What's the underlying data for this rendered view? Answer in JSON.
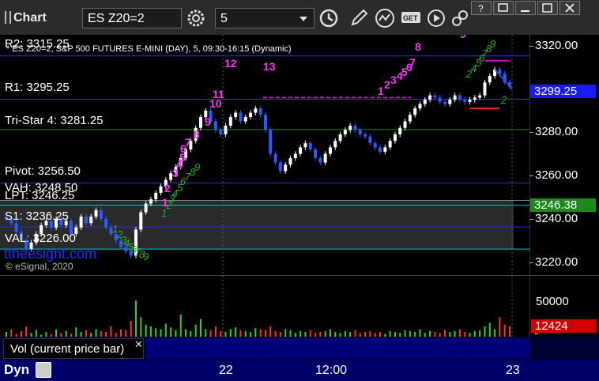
{
  "app": {
    "title": "Chart"
  },
  "toolbar": {
    "symbol": "ES Z20=2",
    "interval": "5"
  },
  "chart_subtitle": "* ES Z20=2, S&P 500 FUTURES E-MINI (DAY), 5, 09:30-16:15 (Dynamic)",
  "watermark": "ttheesight.com",
  "copyright": "© eSignal, 2020",
  "levels": [
    {
      "label": "R2: 3315.25",
      "price": 3315.25,
      "color": "#2b2bff"
    },
    {
      "label": "R1: 3295.25",
      "price": 3295.25,
      "color": "#2b2bff"
    },
    {
      "label": "Tri-Star 4: 3281.25",
      "price": 3281.25,
      "color": "#2e7d32"
    },
    {
      "label": "Pivot: 3256.50",
      "price": 3256.5,
      "color": "#2b2bff"
    },
    {
      "label": "LPT: 3246.25",
      "price": 3246.25,
      "color": "#00c8c8"
    },
    {
      "label": "VAH: 3248.50",
      "price": 3248.5,
      "color": "#888888"
    },
    {
      "label": "S1: 3236.25",
      "price": 3236.25,
      "color": "#2b2bff"
    },
    {
      "label": "VAL: 3226.00",
      "price": 3226.0,
      "color": "#00c8c8"
    }
  ],
  "price_scale": {
    "ticks": [
      "3320.00",
      "3280.00",
      "3260.00",
      "3240.00",
      "3220.00"
    ]
  },
  "price_badges": [
    {
      "text": "3299.25",
      "price": 3299.25,
      "color": "#1a1aff"
    },
    {
      "text": "3246.38",
      "price": 3246.38,
      "color": "#1a8a1a"
    }
  ],
  "volume": {
    "label": "Vol (current price bar)",
    "ticks": [
      "50000",
      "0"
    ],
    "badge": "12424",
    "badge_color": "#d00000"
  },
  "time_axis": {
    "labels": [
      "22",
      "12:00",
      "23"
    ]
  },
  "bottom": {
    "mode": "Dyn"
  },
  "annotations": {
    "magenta_counts": [
      "1",
      "2",
      "3",
      "4",
      "5",
      "6",
      "7",
      "8",
      "9",
      "10",
      "11",
      "12",
      "13",
      "1",
      "2",
      "3",
      "4",
      "5",
      "6",
      "7",
      "8",
      "9",
      "10",
      "1",
      "2"
    ],
    "green_counts": [
      "1",
      "2",
      "3",
      "4",
      "5",
      "6",
      "7",
      "8",
      "9",
      "1",
      "2",
      "3",
      "4",
      "5",
      "6",
      "7",
      "8",
      "9",
      "2",
      "4",
      "5",
      "6",
      "7",
      "8",
      "9",
      "2"
    ]
  },
  "chart_data": {
    "type": "candlestick",
    "title": "ES Z20=2, S&P 500 FUTURES E-MINI (DAY), 5, 09:30-16:15 (Dynamic)",
    "ylim": [
      3214,
      3325
    ],
    "x_labels": [
      "22",
      "12:00",
      "23"
    ],
    "series": [
      {
        "name": "price",
        "values": [
          3240,
          3238,
          3234,
          3230,
          3226,
          3229,
          3233,
          3237,
          3239,
          3236,
          3240,
          3237,
          3239,
          3233,
          3236,
          3241,
          3238,
          3241,
          3244,
          3240,
          3236,
          3233,
          3230,
          3227,
          3225,
          3223,
          3235,
          3243,
          3247,
          3249,
          3252,
          3255,
          3258,
          3261,
          3264,
          3268,
          3272,
          3276,
          3282,
          3287,
          3290,
          3285,
          3281,
          3279,
          3283,
          3287,
          3289,
          3285,
          3287,
          3289,
          3291,
          3288,
          3281,
          3270,
          3266,
          3262,
          3265,
          3268,
          3270,
          3273,
          3275,
          3272,
          3268,
          3266,
          3270,
          3273,
          3276,
          3279,
          3281,
          3283,
          3281,
          3279,
          3278,
          3275,
          3273,
          3271,
          3273,
          3276,
          3279,
          3282,
          3285,
          3288,
          3291,
          3293,
          3295,
          3297,
          3296,
          3294,
          3293,
          3295,
          3297,
          3295,
          3294,
          3295,
          3296,
          3297,
          3303,
          3306,
          3309,
          3307,
          3303,
          3301
        ]
      },
      {
        "name": "volume",
        "values": [
          6000,
          9000,
          4000,
          7000,
          12000,
          5000,
          8000,
          3000,
          6000,
          4000,
          9000,
          5000,
          7000,
          4000,
          11000,
          6000,
          8000,
          5000,
          9000,
          7000,
          6000,
          12000,
          5000,
          9000,
          8000,
          18000,
          40000,
          22000,
          14000,
          12000,
          10000,
          9000,
          15000,
          11000,
          8000,
          25000,
          9000,
          7000,
          14000,
          20000,
          9000,
          8000,
          12000,
          7000,
          6000,
          9000,
          11000,
          8000,
          7000,
          6000,
          10000,
          9000,
          8000,
          12000,
          7000,
          6000,
          9000,
          8000,
          5000,
          7000,
          6000,
          8000,
          5000,
          6000,
          7000,
          9000,
          6000,
          5000,
          7000,
          6000,
          8000,
          5000,
          6000,
          7000,
          5000,
          6000,
          4000,
          7000,
          6000,
          5000,
          8000,
          7000,
          6000,
          9000,
          5000,
          7000,
          6000,
          5000,
          8000,
          6000,
          7000,
          9000,
          6000,
          5000,
          7000,
          8000,
          12000,
          16000,
          9000,
          22000,
          14000,
          12424
        ]
      }
    ]
  }
}
